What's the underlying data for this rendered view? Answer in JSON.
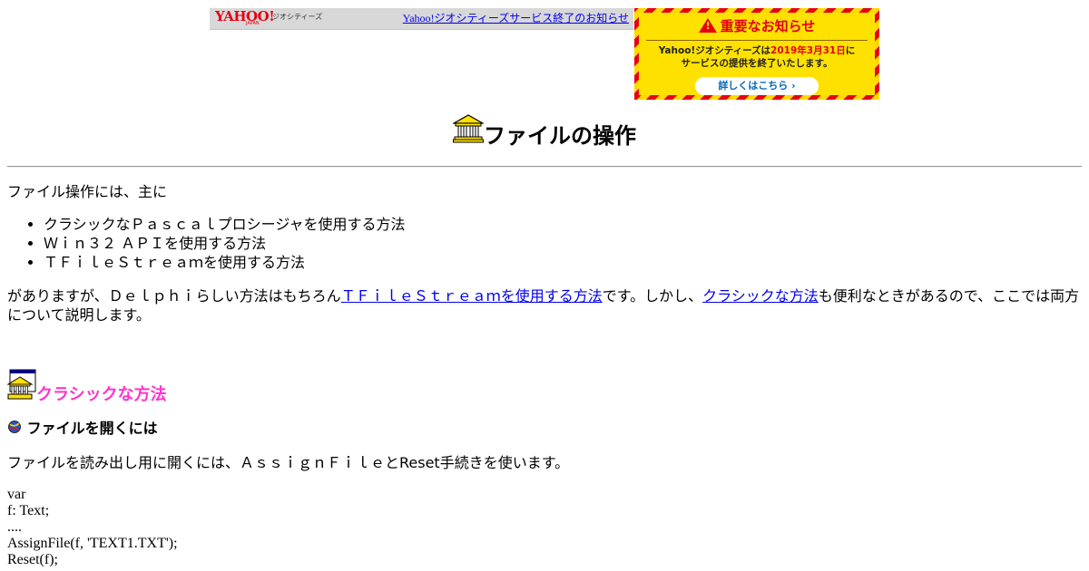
{
  "banner": {
    "logo_text": "YAHOO!",
    "logo_sub": "JAPAN",
    "service_label": "ジオシティーズ",
    "link_text": "Yahoo!ジオシティーズサービス終了のお知らせ"
  },
  "notice": {
    "title": "重要なお知らせ",
    "line1_prefix": "Yahoo!ジオシティーズは",
    "line1_date": "2019年3月31日",
    "line1_suffix": "に",
    "line2": "サービスの提供を終了いたします。",
    "button": "詳しくはこちら ›",
    "colors": {
      "red": "#e60012",
      "yellow": "#ffe100"
    }
  },
  "page": {
    "title": "ファイルの操作",
    "intro": "ファイル操作には、主に",
    "methods": [
      "クラシックなＰａｓｃａｌプロシージャを使用する方法",
      "Ｗｉｎ３２ ＡＰＩを使用する方法",
      "ＴＦｉｌｅＳｔｒｅａｍを使用する方法"
    ],
    "para2": {
      "part1": "がありますが、Ｄｅｌｐｈｉらしい方法はもちろん",
      "link1": "ＴＦｉｌｅＳｔｒｅａｍを使用する方法",
      "part2": "です。しかし、",
      "link2": "クラシックな方法",
      "part3": "も便利なときがあるので、ここでは両方について説明します。"
    },
    "section1_title": "クラシックな方法",
    "subsection1_title": "ファイルを開くには",
    "para3": "ファイルを読み出し用に開くには、ＡｓｓｉｇｎＦｉｌｅとReset手続きを使います。",
    "code_lines": [
      "var",
      "f: Text;",
      "....",
      "AssignFile(f, 'TEXT1.TXT');",
      "Reset(f);"
    ],
    "section_color": "#ff33cc"
  }
}
